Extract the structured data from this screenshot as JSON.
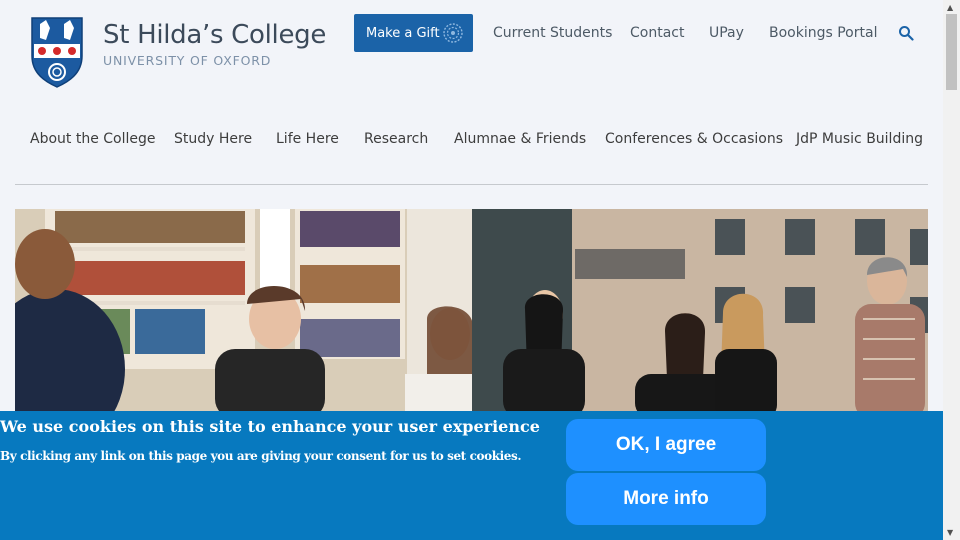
{
  "brand": {
    "name": "St Hilda’s College",
    "subtitle": "UNIVERSITY OF OXFORD"
  },
  "utility_nav": {
    "gift_label": "Make a Gift",
    "links": [
      "Current Students",
      "Contact",
      "UPay",
      "Bookings Portal"
    ]
  },
  "main_nav": {
    "items": [
      "About the College",
      "Study Here",
      "Life Here",
      "Research",
      "Alumnae & Friends",
      "Conferences & Occasions",
      "JdP Music Building"
    ]
  },
  "cookie_banner": {
    "title": "We use cookies on this site to enhance your user experience",
    "subtitle": "By clicking any link on this page you are giving your consent for us to set cookies.",
    "agree_label": "OK, I agree",
    "more_label": "More info"
  },
  "colors": {
    "accent": "#1b63a8",
    "cookie_bg": "#0779bf",
    "cookie_button": "#1e90ff"
  }
}
